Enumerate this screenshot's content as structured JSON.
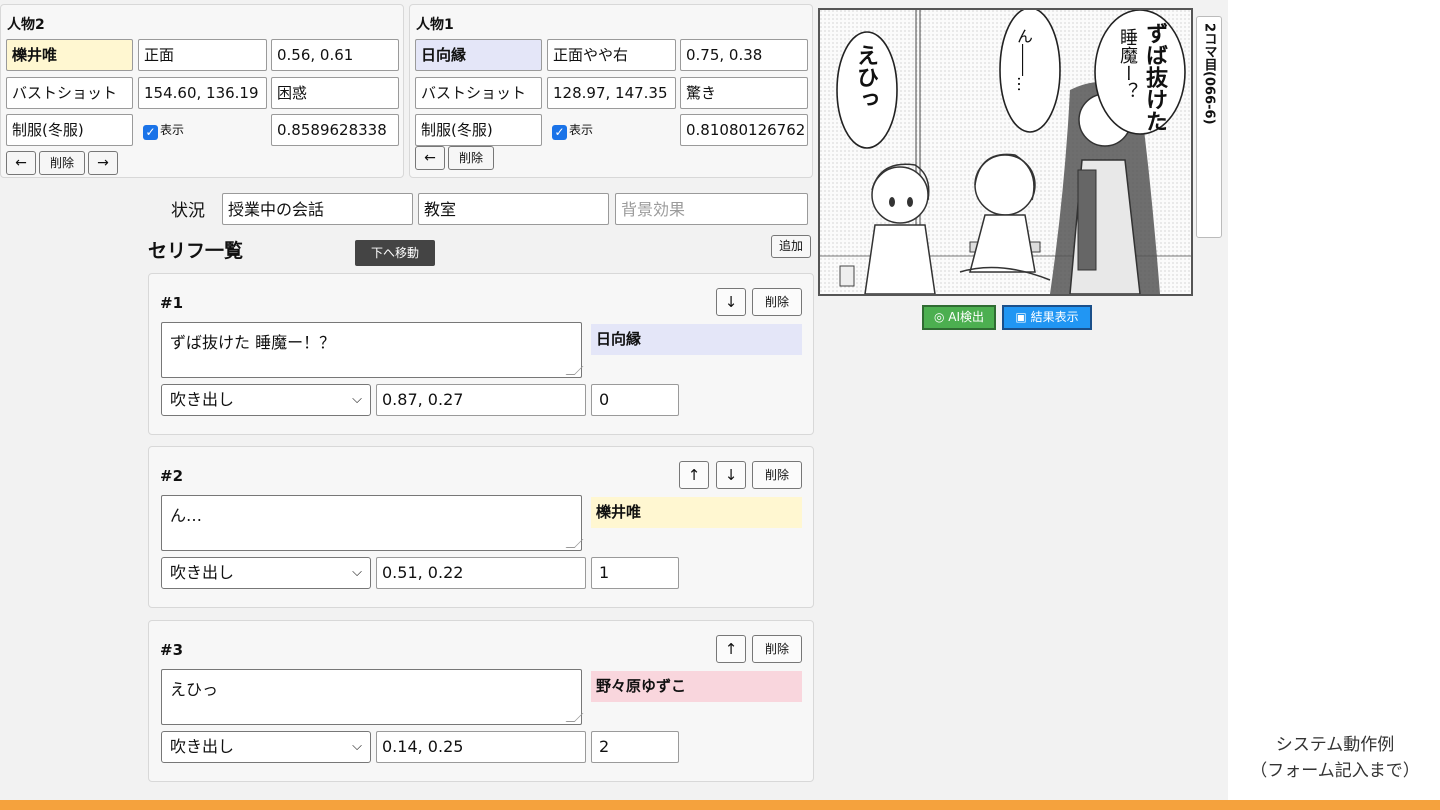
{
  "character2": {
    "title": "人物2",
    "name": "櫟井唯",
    "name_color": "#fff7d1",
    "direction": "正面",
    "position": "0.56, 0.61",
    "shot": "バストショット",
    "size": "154.60, 136.19",
    "emotion": "困惑",
    "outfit": "制服(冬服)",
    "show_label": "表示",
    "confidence": "0.8589628338",
    "prev_label": "←",
    "delete_label": "削除",
    "next_label": "→"
  },
  "character1": {
    "title": "人物1",
    "name": "日向縁",
    "name_color": "#e4e6f8",
    "direction": "正面やや右",
    "position": "0.75, 0.38",
    "shot": "バストショット",
    "size": "128.97, 147.35",
    "emotion": "驚き",
    "outfit": "制服(冬服)",
    "show_label": "表示",
    "confidence": "0.81080126762",
    "prev_label": "←",
    "delete_label": "削除"
  },
  "situation": {
    "label": "状況",
    "value": "授業中の会話",
    "place": "教室",
    "effect_placeholder": "背景効果"
  },
  "lines_section": {
    "title": "セリフ一覧",
    "tooltip": "下へ移動",
    "add_label": "追加"
  },
  "lines": [
    {
      "num": "#1",
      "text": "ずば抜けた 睡魔ー！？",
      "speaker": "日向縁",
      "speaker_color": "#e4e6f8",
      "type": "吹き出し",
      "position": "0.87, 0.27",
      "order": "0",
      "down": "↓",
      "delete": "削除"
    },
    {
      "num": "#2",
      "text": "ん…",
      "speaker": "櫟井唯",
      "speaker_color": "#fff7d1",
      "type": "吹き出し",
      "position": "0.51, 0.22",
      "order": "1",
      "up": "↑",
      "down": "↓",
      "delete": "削除"
    },
    {
      "num": "#3",
      "text": "えひっ",
      "speaker": "野々原ゆずこ",
      "speaker_color": "#f9d6dd",
      "type": "吹き出し",
      "position": "0.14, 0.25",
      "order": "2",
      "up": "↑",
      "delete": "削除"
    }
  ],
  "manga": {
    "bubble_left": "えひっ",
    "bubble_mid": "ん――…",
    "bubble_right_1": "ずば抜けた",
    "bubble_right_2": "睡魔ー？",
    "side_tab": "2コマ目(066-6)"
  },
  "actions": {
    "ai_detect": "AI検出",
    "show_result": "結果表示"
  },
  "caption": {
    "line1": "システム動作例",
    "line2": "（フォーム記入まで）"
  }
}
